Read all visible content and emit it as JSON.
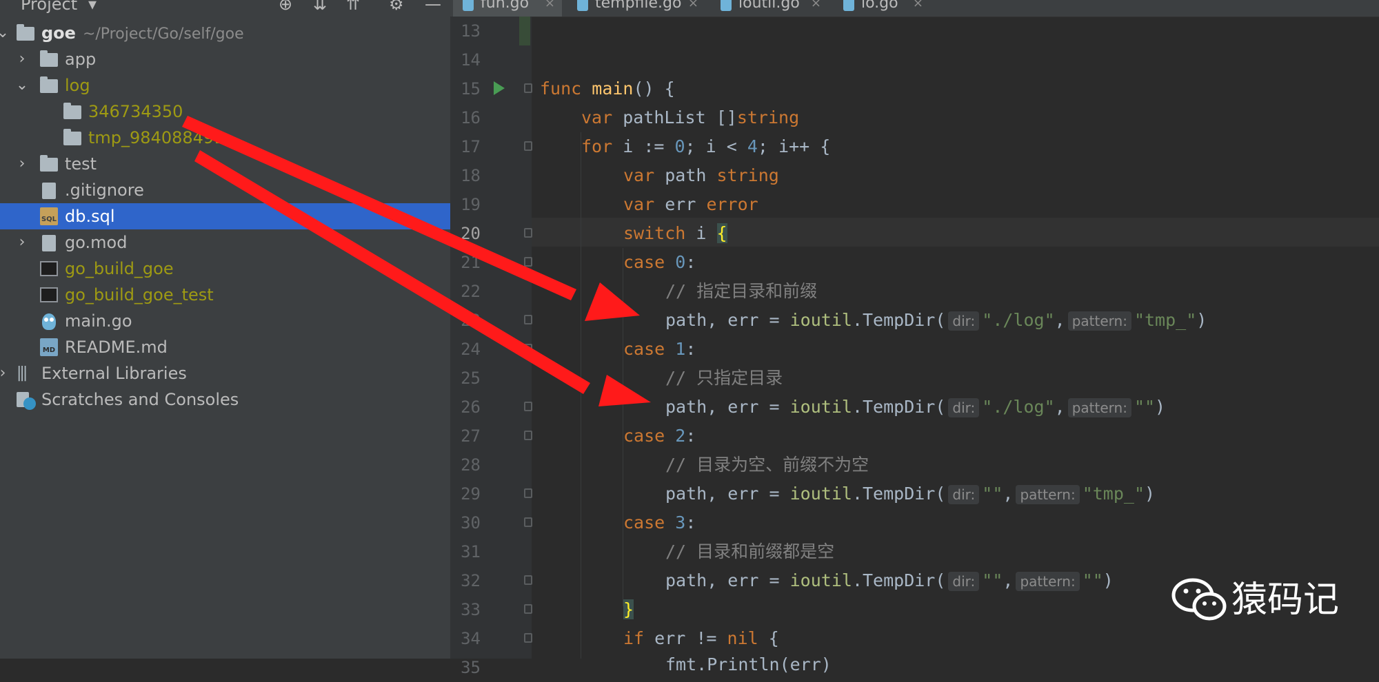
{
  "project_panel": {
    "title": "Project",
    "tree": [
      {
        "label": "goe",
        "path": "~/Project/Go/self/goe",
        "icon": "folder-icon",
        "expanded": true
      },
      {
        "label": "app",
        "icon": "folder-icon"
      },
      {
        "label": "log",
        "icon": "folder-icon",
        "expanded": true
      },
      {
        "label": "346734350",
        "icon": "folder-icon"
      },
      {
        "label": "tmp_984088491",
        "icon": "folder-icon"
      },
      {
        "label": "test",
        "icon": "folder-icon"
      },
      {
        "label": ".gitignore",
        "icon": "gitignore-file-icon"
      },
      {
        "label": "db.sql",
        "icon": "sql-file-icon",
        "selected": true
      },
      {
        "label": "go.mod",
        "icon": "gomod-file-icon"
      },
      {
        "label": "go_build_goe",
        "icon": "terminal-icon"
      },
      {
        "label": "go_build_goe_test",
        "icon": "terminal-icon"
      },
      {
        "label": "main.go",
        "icon": "go-file-icon"
      },
      {
        "label": "README.md",
        "icon": "markdown-file-icon"
      },
      {
        "label": "External Libraries",
        "icon": "libraries-icon"
      },
      {
        "label": "Scratches and Consoles",
        "icon": "scratches-icon"
      }
    ]
  },
  "tabs": [
    {
      "label": "fun.go",
      "active": true
    },
    {
      "label": "tempfile.go"
    },
    {
      "label": "ioutil.go"
    },
    {
      "label": "io.go"
    }
  ],
  "icon_text": {
    "sql": "SQL",
    "md": "MD",
    "close": "×",
    "chevron_right": "›",
    "chevron_down": "⌄",
    "caret": "▾",
    "locate": "⊕",
    "expand": "⇊",
    "collapse": "⇈",
    "gear": "⚙",
    "minimize": "—",
    "libs": "|||"
  },
  "editor": {
    "line_numbers": [
      "13",
      "14",
      "15",
      "16",
      "17",
      "18",
      "19",
      "20",
      "21",
      "22",
      "23",
      "24",
      "25",
      "26",
      "27",
      "28",
      "29",
      "30",
      "31",
      "32",
      "33",
      "34",
      "35"
    ],
    "current_line": "20",
    "hints": {
      "dir": "dir:",
      "pattern": "pattern:"
    },
    "code": {
      "l15": {
        "kw": "func",
        "fn": "main",
        "rest": "() {"
      },
      "l16": {
        "kw": "var",
        "ident": "pathList",
        "br": "[]",
        "type": "string"
      },
      "l17": {
        "kw": "for",
        "a": "i := ",
        "n0": "0",
        "b": "; i < ",
        "n4": "4",
        "c": "; i++ {"
      },
      "l18": {
        "kw": "var",
        "ident": "path",
        "type": "string"
      },
      "l19": {
        "kw": "var",
        "ident": "err",
        "type": "error"
      },
      "l20": {
        "kw": "switch",
        "ident": "i",
        "brace": "{"
      },
      "l21": {
        "kw": "case",
        "num": "0",
        "colon": ":"
      },
      "l22": {
        "cmt": "// 指定目录和前缀"
      },
      "l23": {
        "lhs": "path, err = ",
        "pkg": "ioutil",
        "call": ".TempDir(",
        "dir": "\"./log\"",
        "sep": ",",
        "pattern": "\"tmp_\"",
        "end": ")"
      },
      "l24": {
        "kw": "case",
        "num": "1",
        "colon": ":"
      },
      "l25": {
        "cmt": "// 只指定目录"
      },
      "l26": {
        "lhs": "path, err = ",
        "pkg": "ioutil",
        "call": ".TempDir(",
        "dir": "\"./log\"",
        "sep": ",",
        "pattern": "\"\"",
        "end": ")"
      },
      "l27": {
        "kw": "case",
        "num": "2",
        "colon": ":"
      },
      "l28": {
        "cmt": "// 目录为空、前缀不为空"
      },
      "l29": {
        "lhs": "path, err = ",
        "pkg": "ioutil",
        "call": ".TempDir(",
        "dir": "\"\"",
        "sep": ",",
        "pattern": "\"tmp_\"",
        "end": ")"
      },
      "l30": {
        "kw": "case",
        "num": "3",
        "colon": ":"
      },
      "l31": {
        "cmt": "// 目录和前缀都是空"
      },
      "l32": {
        "lhs": "path, err = ",
        "pkg": "ioutil",
        "call": ".TempDir(",
        "dir": "\"\"",
        "sep": ",",
        "pattern": "\"\"",
        "end": ")"
      },
      "l33": {
        "brace": "}"
      },
      "l34": {
        "kw": "if",
        "rest": "err != ",
        "nil": "nil",
        "end": " {"
      },
      "l35": {
        "partial": "fmt.Println(err)"
      }
    }
  },
  "annotations": {
    "arrow_color": "#ff0000"
  },
  "watermark": {
    "text": "猿码记",
    "icon": "wechat-icon"
  },
  "colors": {
    "selection": "#2f65ca",
    "keyword": "#cc7832",
    "function": "#ffc66d",
    "number": "#6897bb",
    "string": "#6a8759",
    "comment": "#808080",
    "vcs_added": "#9e9a13"
  }
}
